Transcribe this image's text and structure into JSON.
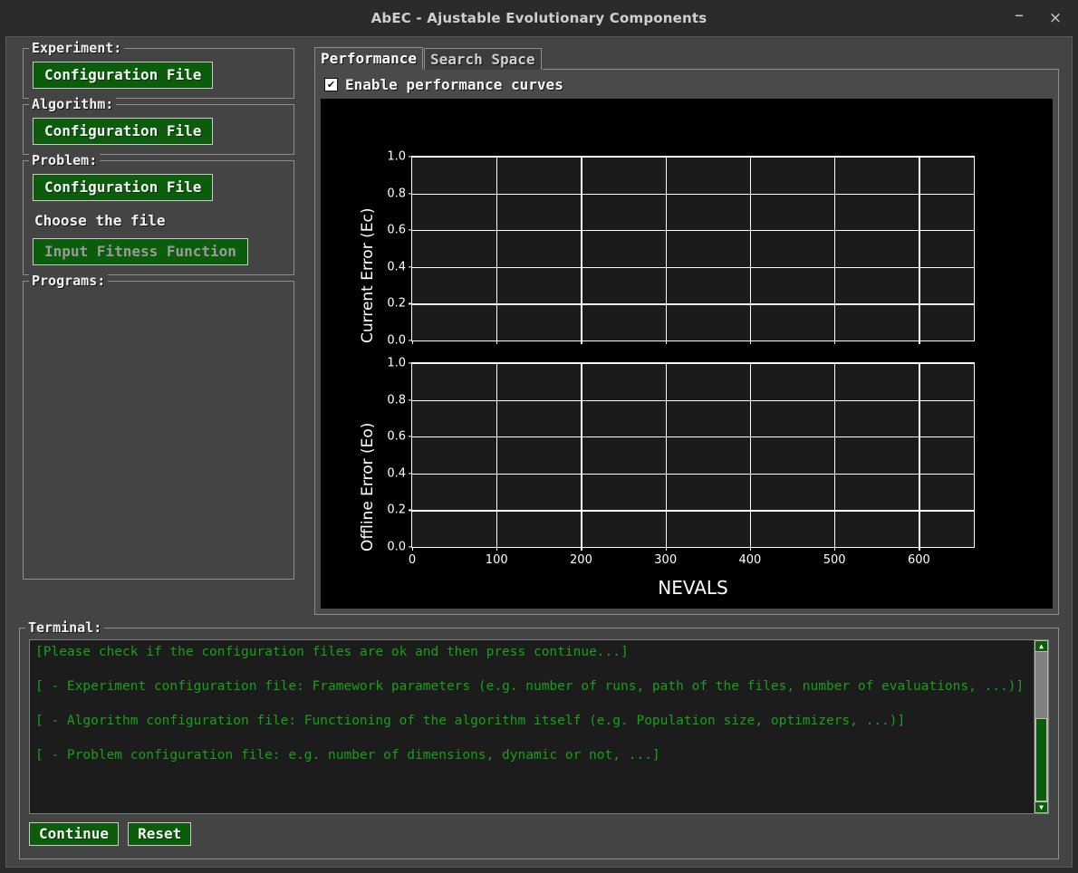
{
  "window": {
    "title": "AbEC - Ajustable Evolutionary Components",
    "minimize_glyph": "–",
    "close_glyph": "×"
  },
  "sidebar": {
    "groups": [
      {
        "label": "Experiment:",
        "button": "Configuration File"
      },
      {
        "label": "Algorithm:",
        "button": "Configuration File"
      },
      {
        "label": "Problem:",
        "button": "Configuration File",
        "hint": "Choose the file",
        "button2": "Input Fitness Function"
      },
      {
        "label": "Programs:"
      }
    ]
  },
  "notebook": {
    "tabs": [
      {
        "label": "Performance",
        "active": true
      },
      {
        "label": "Search Space",
        "active": false
      }
    ],
    "checkbox": {
      "label": "Enable performance curves",
      "checked": true,
      "check_glyph": "✔"
    }
  },
  "chart_data": [
    {
      "type": "line",
      "title": "",
      "xlabel": "",
      "ylabel": "Current Error (Ec)",
      "xlim": [
        0,
        665
      ],
      "ylim": [
        0.0,
        1.0
      ],
      "xticks": [
        0,
        100,
        200,
        300,
        400,
        500,
        600
      ],
      "yticks": [
        0.0,
        0.2,
        0.4,
        0.6,
        0.8,
        1.0
      ],
      "ytick_labels": [
        "0.0",
        "0.2",
        "0.4",
        "0.6",
        "0.8",
        "1.0"
      ],
      "xtick_labels": [
        "",
        "",
        "",
        "",
        "",
        "",
        ""
      ],
      "grid": true,
      "series": [],
      "bg": "#1b1b1b",
      "fg": "#ffffff"
    },
    {
      "type": "line",
      "title": "",
      "xlabel": "NEVALS",
      "ylabel": "Offline Error (Eo)",
      "xlim": [
        0,
        665
      ],
      "ylim": [
        0.0,
        1.0
      ],
      "xticks": [
        0,
        100,
        200,
        300,
        400,
        500,
        600
      ],
      "yticks": [
        0.0,
        0.2,
        0.4,
        0.6,
        0.8,
        1.0
      ],
      "ytick_labels": [
        "0.0",
        "0.2",
        "0.4",
        "0.6",
        "0.8",
        "1.0"
      ],
      "xtick_labels": [
        "0",
        "100",
        "200",
        "300",
        "400",
        "500",
        "600"
      ],
      "grid": true,
      "series": [],
      "bg": "#1b1b1b",
      "fg": "#ffffff"
    }
  ],
  "terminal": {
    "label": "Terminal:",
    "text": "[Please check if the configuration files are ok and then press continue...]\n\n[ - Experiment configuration file: Framework parameters (e.g. number of runs, path of the files, number of evaluations, ...)]\n\n[ - Algorithm configuration file: Functioning of the algorithm itself (e.g. Population size, optimizers, ...)]\n\n[ - Problem configuration file: e.g. number of dimensions, dynamic or not, ...]",
    "scroll_up_glyph": "▲",
    "scroll_down_glyph": "▼"
  },
  "actions": {
    "continue_label": "Continue",
    "reset_label": "Reset"
  },
  "colors": {
    "button_green": "#0b5c0b",
    "terminal_green": "#16a016",
    "panel_gray": "#444444",
    "figure_black": "#000000",
    "axes_bg": "#1b1b1b"
  }
}
